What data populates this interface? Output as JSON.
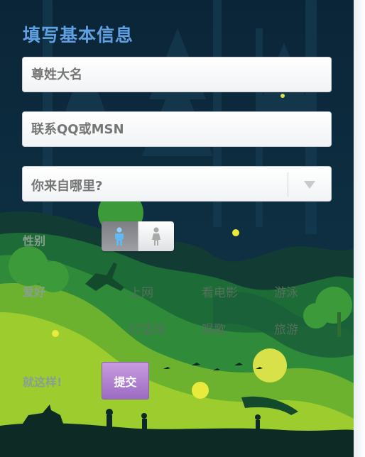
{
  "form": {
    "title": "填写基本信息",
    "name_placeholder": "尊姓大名",
    "contact_placeholder": "联系QQ或MSN",
    "origin_select_value": "你来自哪里?"
  },
  "gender": {
    "label": "性别",
    "selected": "male",
    "options": [
      {
        "value": "male",
        "icon": "male-icon"
      },
      {
        "value": "female",
        "icon": "female-icon"
      }
    ]
  },
  "hobbies": {
    "label": "爱好",
    "options": [
      "上网",
      "看电影",
      "游泳",
      "打篮球",
      "唱歌",
      "旅游"
    ]
  },
  "submit": {
    "label": "就这样!",
    "button_label": "提交"
  },
  "colors": {
    "title": "#5fa0e0",
    "night_sky": "#0d2a3f",
    "hill_dark": "#1d6b37",
    "hill_light": "#9ccc2e",
    "submit_button": "#b589d3"
  }
}
